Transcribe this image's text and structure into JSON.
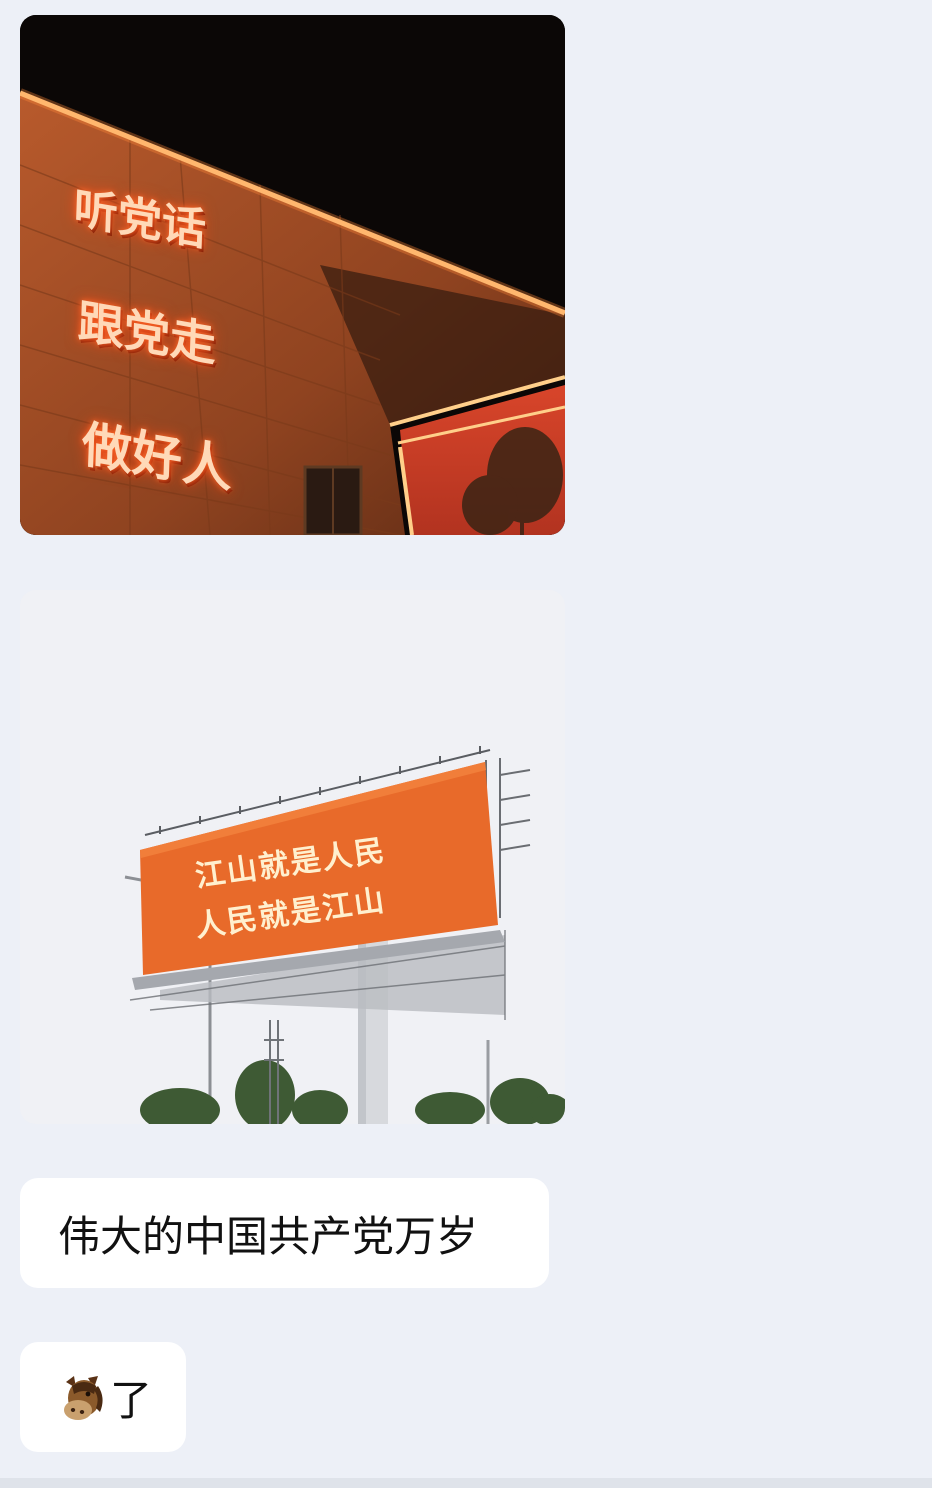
{
  "chat": {
    "messages": [
      {
        "type": "image",
        "sign_lines": [
          "听党话",
          "跟党走",
          "做好人"
        ]
      },
      {
        "type": "image",
        "billboard_lines": [
          "江山就是人民",
          "人民就是江山"
        ]
      },
      {
        "type": "text",
        "text": "伟大的中国共产党万岁"
      },
      {
        "type": "text",
        "emoji_icon": "horse-face-icon",
        "text": "了"
      }
    ]
  },
  "colors": {
    "chat_background": "#edf0f7",
    "bubble_background": "#ffffff",
    "sign_glow": "#ff6a2a",
    "billboard_orange": "#e86a2a"
  }
}
